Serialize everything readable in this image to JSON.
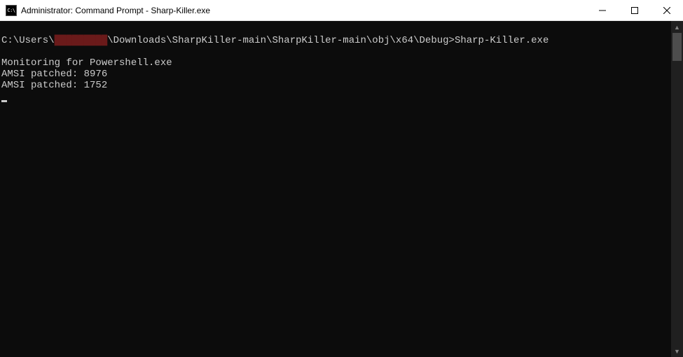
{
  "window": {
    "title": "Administrator: Command Prompt - Sharp-Killer.exe",
    "icon_label": "C:\\"
  },
  "terminal": {
    "prompt_prefix": "C:\\Users\\",
    "redacted_placeholder": "█████████",
    "prompt_suffix": "\\Downloads\\SharpKiller-main\\SharpKiller-main\\obj\\x64\\Debug>",
    "command": "Sharp-Killer.exe",
    "output_lines": [
      "Monitoring for Powershell.exe",
      "AMSI patched: 8976",
      "AMSI patched: 1752"
    ]
  },
  "controls": {
    "minimize": "Minimize",
    "maximize": "Maximize",
    "close": "Close"
  },
  "scrollbar": {
    "up": "▲",
    "down": "▼"
  }
}
